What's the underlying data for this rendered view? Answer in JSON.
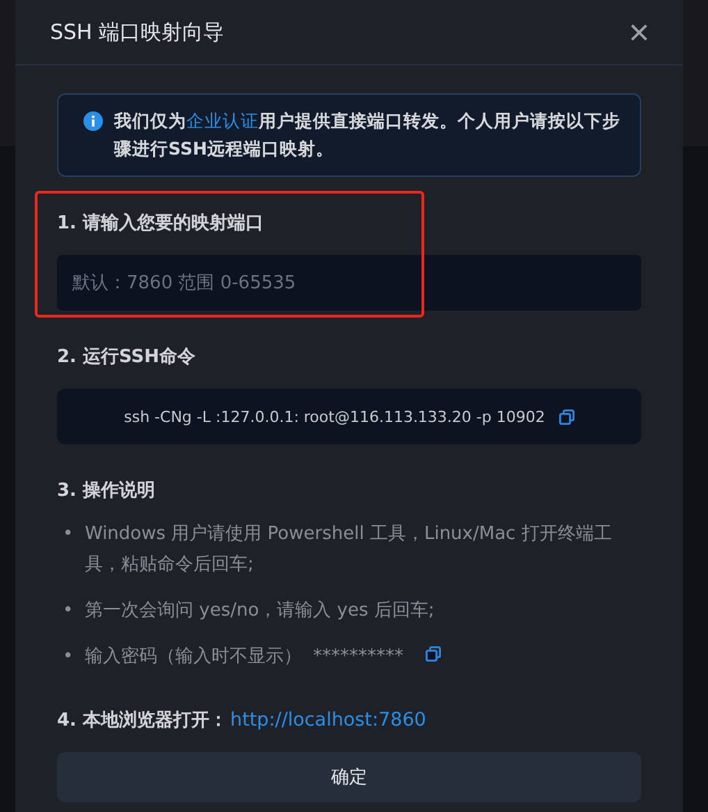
{
  "dialog": {
    "title": "SSH 端口映射向导",
    "close": "×"
  },
  "notice": {
    "text_before": "我们仅为",
    "link": "企业认证",
    "text_after": "用户提供直接端口转发。个人用户请按以下步骤进行SSH远程端口映射。"
  },
  "steps": [
    {
      "kind": "input",
      "heading": "1. 请输入您要的映射端口",
      "placeholder": "默认：7860 范围 0-65535",
      "highlighted": true
    },
    {
      "kind": "command",
      "heading": "2. 运行SSH命令",
      "command": "ssh -CNg -L :127.0.0.1: root@116.113.133.20 -p 10902"
    },
    {
      "kind": "list",
      "heading": "3. 操作说明",
      "items": [
        {
          "bullet": "•",
          "text": "Windows 用户请使用 Powershell 工具，Linux/Mac 打开终端工具，粘贴命令后回车;"
        },
        {
          "bullet": "•",
          "text": "第一次会询问 yes/no，请输入 yes 后回车;"
        },
        {
          "bullet": "•",
          "text": "输入密码（输入时不显示）",
          "secret": "**********"
        }
      ]
    },
    {
      "kind": "link",
      "heading": "4. 本地浏览器打开：",
      "url": "http://localhost:7860"
    }
  ],
  "confirm_button": "确定"
}
